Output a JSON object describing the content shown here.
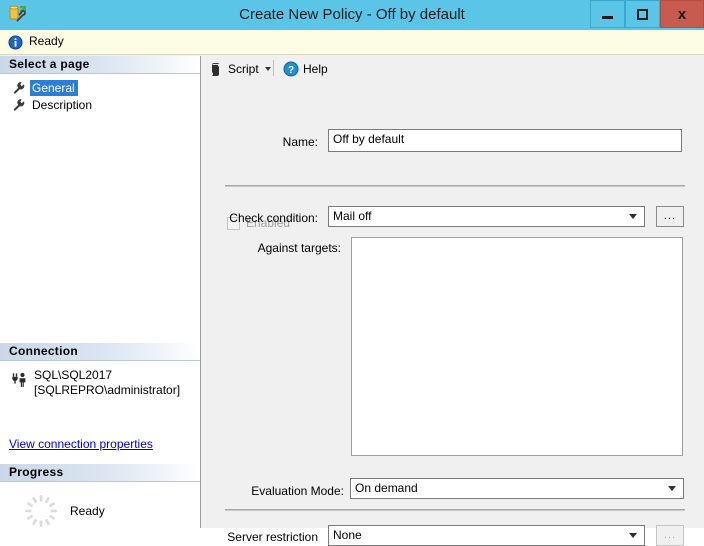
{
  "window": {
    "title": "Create New Policy - Off by default",
    "app_icon": "policy-script-icon",
    "minimize_label": "",
    "maximize_label": "",
    "close_label": "x",
    "titlebar_color": "#5bc5e8",
    "close_color": "#c75b50"
  },
  "infobar": {
    "icon": "info-icon",
    "text": "Ready",
    "background": "#fdfce4"
  },
  "sidebar": {
    "select_page_header": "Select a page",
    "pages": [
      {
        "label": "General",
        "icon": "wrench-icon",
        "selected": true
      },
      {
        "label": "Description",
        "icon": "wrench-icon",
        "selected": false
      }
    ],
    "connection_header": "Connection",
    "connection": {
      "icon": "connection-icon",
      "server": "SQL\\SQL2017",
      "user": "[SQLREPRO\\administrator]",
      "link": "View connection properties",
      "link_color": "#0000cc"
    },
    "progress_header": "Progress",
    "progress": {
      "icon": "spinner-icon",
      "text": "Ready"
    },
    "selection_color": "#2a7fd4"
  },
  "toolbar": {
    "script_label": "Script",
    "script_icon": "script-icon",
    "script_caret": "chevron-down-icon",
    "help_label": "Help",
    "help_icon": "help-icon"
  },
  "form": {
    "name_label": "Name:",
    "name_value": "Off by default",
    "enabled_label": "Enabled",
    "enabled_checked": false,
    "enabled_disabled": true,
    "check_condition_label": "Check condition:",
    "check_condition_value": "Mail off",
    "check_condition_browse": "...",
    "against_targets_label": "Against targets:",
    "against_targets_items": [],
    "evaluation_mode_label": "Evaluation Mode:",
    "evaluation_mode_value": "On demand",
    "server_restriction_label": "Server restriction",
    "server_restriction_value": "None",
    "server_restriction_browse": "...",
    "server_restriction_browse_disabled": true
  }
}
